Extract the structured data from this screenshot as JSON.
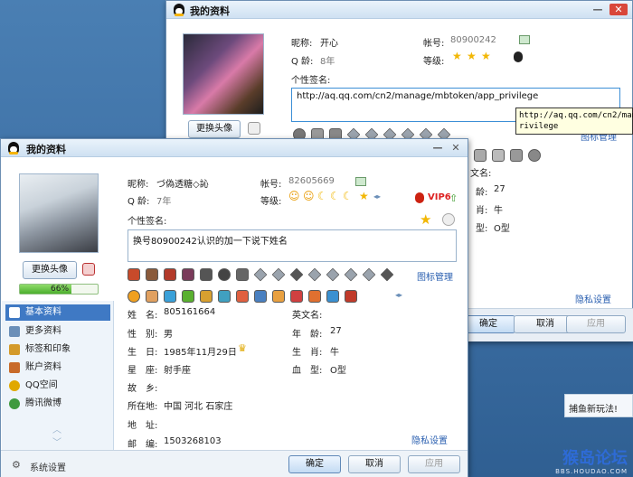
{
  "back_window": {
    "title": "我的资料",
    "nickname_label": "昵称:",
    "nickname": "开心",
    "account_label": "帐号:",
    "account": "80900242",
    "qage_label": "Q 龄:",
    "qage": "8年",
    "level_label": "等级:",
    "change_avatar_label": "更换头像",
    "signature_label": "个性签名:",
    "signature": "http://aq.qq.com/cn2/manage/mbtoken/app_privilege",
    "tooltip_line1": "http://aq.qq.com/cn2/man",
    "tooltip_line2": "rivilege",
    "icon_manage_link": "图标管理",
    "english_name_label": "文名:",
    "age_label": "龄:",
    "age": "27",
    "zodiac_label": "肖:",
    "zodiac": "牛",
    "blood_label": "型:",
    "blood": "O型",
    "privacy_link": "隐私设置",
    "ok_label": "确定",
    "cancel_label": "取消",
    "apply_label": "应用",
    "news_text": "捕鱼新玩法!"
  },
  "front_window": {
    "title": "我的资料",
    "nickname_label": "昵称:",
    "nickname": "づ偽透糖◇訫",
    "account_label": "帐号:",
    "account": "82605669",
    "qage_label": "Q 龄:",
    "qage": "7年",
    "level_label": "等级:",
    "vip_badge": "VIP6",
    "change_avatar_label": "更换头像",
    "progress_text": "66%",
    "progress_value": 0.66,
    "signature_label": "个性签名:",
    "signature": "换号80900242认识的加一下说下姓名",
    "icon_manage_link": "图标管理",
    "privacy_link": "隐私设置",
    "ok_label": "确定",
    "cancel_label": "取消",
    "apply_label": "应用",
    "system_settings_label": "系统设置",
    "sidebar_items": [
      {
        "label": "基本资料",
        "color": "#2f69b5"
      },
      {
        "label": "更多资料",
        "color": "#6b8fb8"
      },
      {
        "label": "标签和印象",
        "color": "#d49a2a"
      },
      {
        "label": "账户资料",
        "color": "#c86b2a"
      },
      {
        "label": "QQ空间",
        "color": "#e0a800"
      },
      {
        "label": "腾讯微博",
        "color": "#3f9a3f"
      }
    ],
    "info": {
      "name_label": "姓　名:",
      "name": "805161664",
      "english_name_label": "英文名:",
      "gender_label": "性　别:",
      "gender": "男",
      "age_label": "年　龄:",
      "age": "27",
      "birthday_label": "生　日:",
      "birthday": "1985年11月29日",
      "zodiac_label": "生　肖:",
      "zodiac": "牛",
      "constellation_label": "星　座:",
      "constellation": "射手座",
      "blood_label": "血　型:",
      "blood": "O型",
      "hometown_label": "故　乡:",
      "location_label": "所在地:",
      "location": "中国  河北  石家庄",
      "address_label": "地　址:",
      "postcode_label": "邮　编:",
      "postcode": "1503268103"
    }
  },
  "watermark": {
    "main": "猴岛论坛",
    "sub": "BBS.HOUDAO.COM"
  }
}
